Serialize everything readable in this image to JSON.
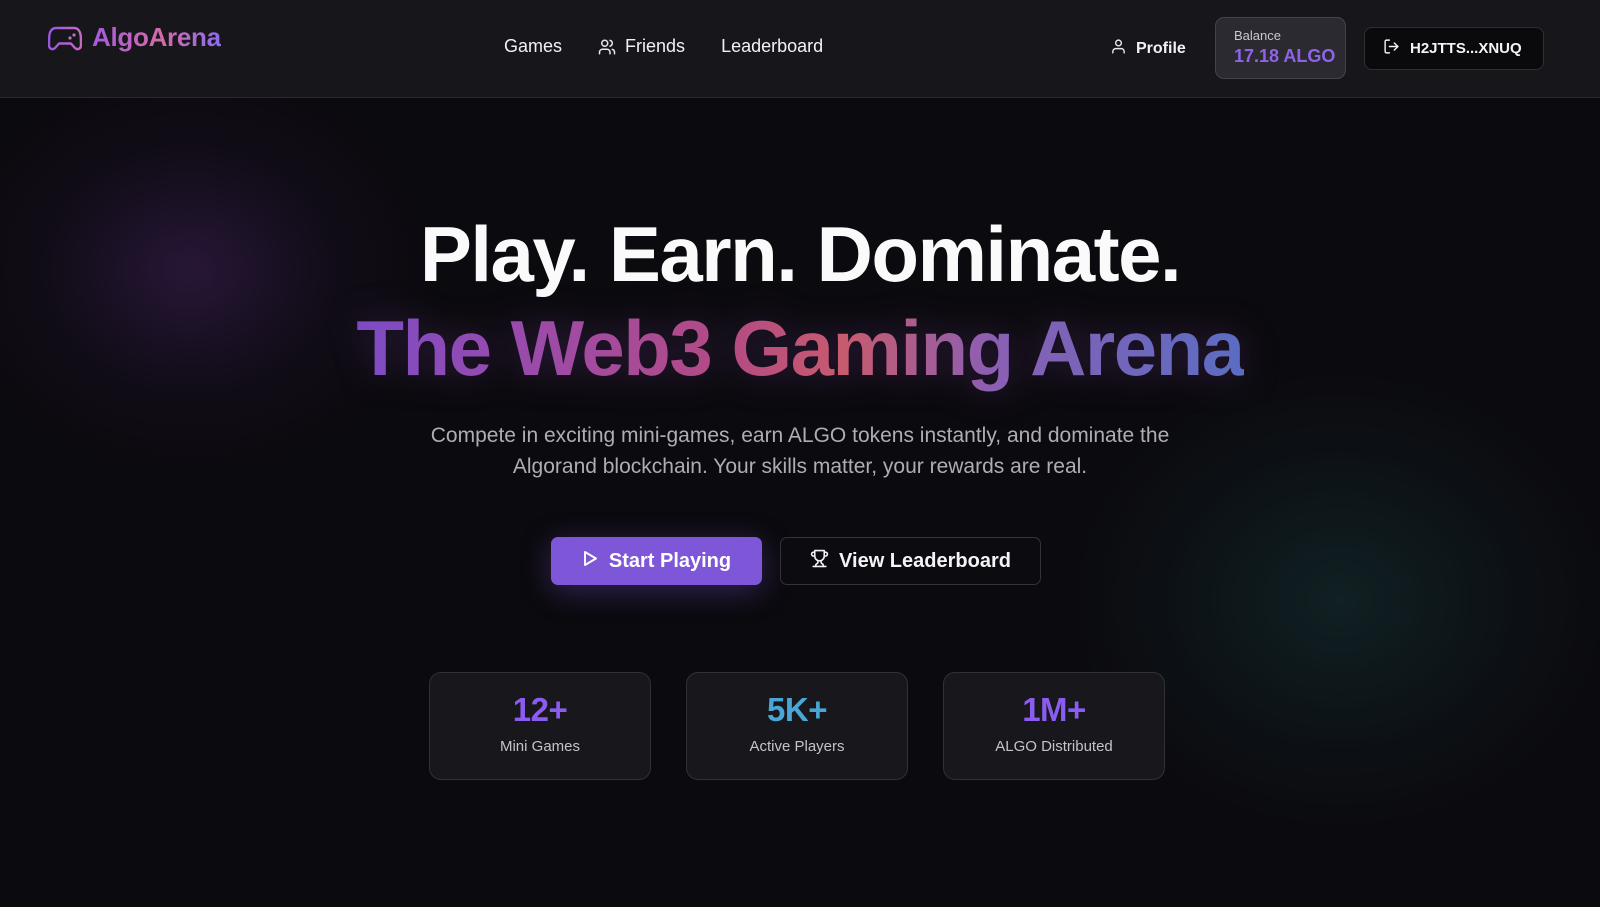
{
  "app": {
    "name": "AlgoArena",
    "icon": "gamepad-icon"
  },
  "nav": {
    "items": [
      {
        "label": "Games",
        "icon": ""
      },
      {
        "label": "Friends",
        "icon": "users-icon"
      },
      {
        "label": "Leaderboard",
        "icon": ""
      }
    ]
  },
  "header": {
    "profile_label": "Profile",
    "balance_label": "Balance",
    "balance_value": "17.18 ALGO",
    "wallet_address": "H2JTTS...XNUQ"
  },
  "hero": {
    "title_line1": "Play. Earn. Dominate.",
    "title_line2": "The Web3 Gaming Arena",
    "subtitle": "Compete in exciting mini-games, earn ALGO tokens instantly, and dominate the Algorand blockchain. Your skills matter, your rewards are real.",
    "primary_cta": "Start Playing",
    "secondary_cta": "View Leaderboard"
  },
  "stats": [
    {
      "value": "12+",
      "label": "Mini Games",
      "color": "#8b5cf0"
    },
    {
      "value": "5K+",
      "label": "Active Players",
      "color": "#4aa6d6"
    },
    {
      "value": "1M+",
      "label": "ALGO Distributed",
      "color": "#8b5cf0"
    }
  ],
  "colors": {
    "accent": "#7d57d8",
    "background": "#0b0a0e",
    "header": "#17161b"
  }
}
